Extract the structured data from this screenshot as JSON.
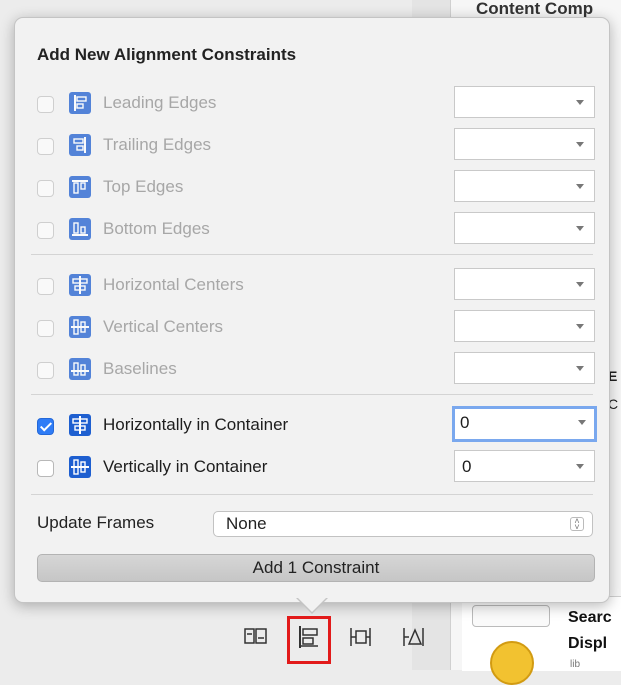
{
  "background": {
    "inspector_title": "Content Comp",
    "peek_e": "E",
    "peek_c": "C",
    "library": {
      "item_title_line1": "Searc",
      "item_title_line2": "Displ",
      "item_sub": "lib"
    }
  },
  "popover": {
    "title": "Add New Alignment Constraints",
    "edge_rows": [
      {
        "label": "Leading Edges",
        "checked": false,
        "enabled": false,
        "value": "",
        "icon": "leading-edges-icon"
      },
      {
        "label": "Trailing Edges",
        "checked": false,
        "enabled": false,
        "value": "",
        "icon": "trailing-edges-icon"
      },
      {
        "label": "Top Edges",
        "checked": false,
        "enabled": false,
        "value": "",
        "icon": "top-edges-icon"
      },
      {
        "label": "Bottom Edges",
        "checked": false,
        "enabled": false,
        "value": "",
        "icon": "bottom-edges-icon"
      }
    ],
    "center_rows": [
      {
        "label": "Horizontal Centers",
        "checked": false,
        "enabled": false,
        "value": "",
        "icon": "horizontal-centers-icon"
      },
      {
        "label": "Vertical Centers",
        "checked": false,
        "enabled": false,
        "value": "",
        "icon": "vertical-centers-icon"
      },
      {
        "label": "Baselines",
        "checked": false,
        "enabled": false,
        "value": "",
        "icon": "baselines-icon"
      }
    ],
    "container_rows": [
      {
        "label": "Horizontally in Container",
        "checked": true,
        "enabled": true,
        "value": "0",
        "icon": "horizontally-in-container-icon"
      },
      {
        "label": "Vertically in Container",
        "checked": false,
        "enabled": true,
        "value": "0",
        "icon": "vertically-in-container-icon"
      }
    ],
    "update_frames": {
      "label": "Update Frames",
      "value": "None"
    },
    "add_button": "Add 1 Constraint"
  },
  "toolbar": {
    "items": [
      "stack-icon",
      "align-icon",
      "pin-icon",
      "resolve-issues-icon"
    ],
    "highlighted": "align-icon"
  },
  "colors": {
    "accent": "#2f7cf6",
    "icon_blue": "#1e5fd0",
    "highlight": "#e21a1a"
  }
}
